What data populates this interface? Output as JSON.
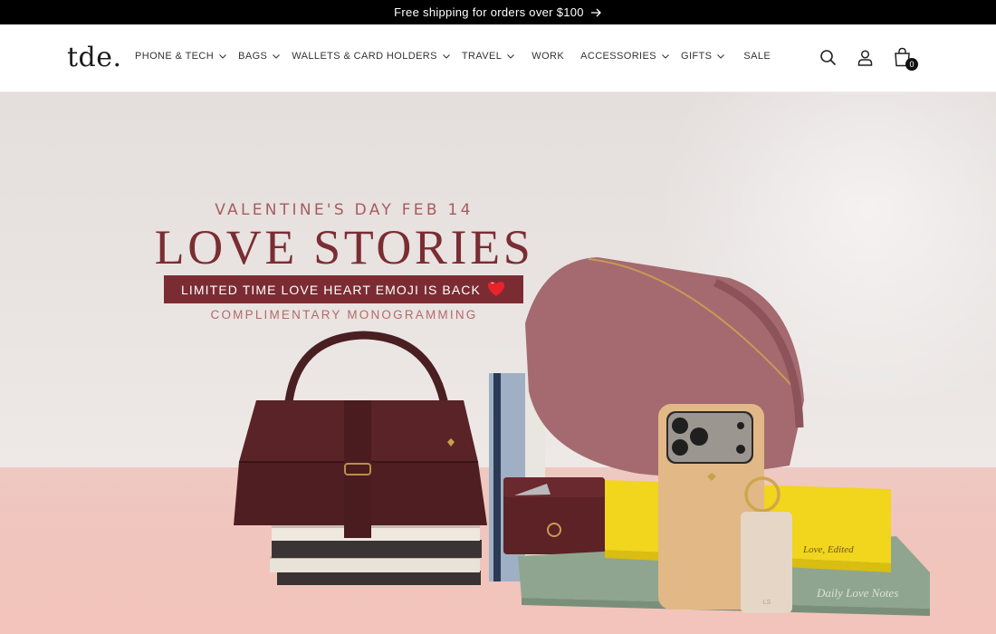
{
  "announcement": {
    "text": "Free shipping for orders over $100",
    "arrow_icon": "arrow-right-icon"
  },
  "header": {
    "logo": "tde.",
    "nav": [
      {
        "label": "PHONE & TECH",
        "has_dropdown": true
      },
      {
        "label": "BAGS",
        "has_dropdown": true
      },
      {
        "label": "WALLETS & CARD HOLDERS",
        "has_dropdown": true
      },
      {
        "label": "TRAVEL",
        "has_dropdown": true
      },
      {
        "label": "WORK",
        "has_dropdown": false
      },
      {
        "label": "ACCESSORIES",
        "has_dropdown": true
      },
      {
        "label": "GIFTS",
        "has_dropdown": true
      },
      {
        "label": "SALE",
        "has_dropdown": false
      }
    ],
    "icons": [
      "search-icon",
      "account-icon",
      "cart-icon"
    ],
    "cart_count": "0"
  },
  "hero": {
    "eyebrow": "VALENTINE'S DAY FEB 14",
    "headline": "LOVE STORIES",
    "promo": "LIMITED TIME LOVE HEART EMOJI IS BACK",
    "promo_icon": "red-heart-icon",
    "subline": "COMPLIMENTARY MONOGRAMMING",
    "book1_title": "Love, Edited",
    "book2_title": "Daily Love Notes",
    "tag_monogram": "LS",
    "colors": {
      "brand_dark": "#7b2c33",
      "eyebrow": "#a45e5d",
      "floor": "#f0c5bd",
      "background": "#e9e4e2"
    }
  }
}
